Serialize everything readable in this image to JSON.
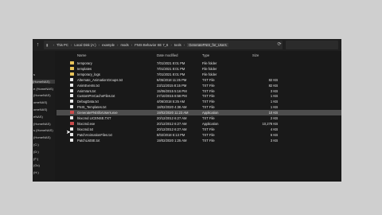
{
  "breadcrumb": [
    "This PC",
    "Local Disk (A:)",
    "example",
    "mods",
    "FNIS Behavior SE 7_6",
    "tools",
    "GenerateFNIS_for_Users"
  ],
  "columns": {
    "name": "Name",
    "date": "Date modified",
    "type": "Type",
    "size": "Size"
  },
  "nav_items": [
    {
      "label": "s",
      "selected": false
    },
    {
      "label": "(HomeNAS)",
      "selected": true
    },
    {
      "label": "e (HomeNAS)",
      "selected": false
    },
    {
      "label": "(HomeNAS)",
      "selected": false
    },
    {
      "label": "omeNAS)",
      "selected": false
    },
    {
      "label": "omeNAS)",
      "selected": false
    },
    {
      "label": "eNAS)",
      "selected": false
    },
    {
      "label": "(HomeNAS)",
      "selected": false
    },
    {
      "label": "s (HomeNAS)",
      "selected": false
    },
    {
      "label": "(HomeNAS)",
      "selected": false
    },
    {
      "label": "(C:)",
      "selected": false
    },
    {
      "label": "(D:)",
      "selected": false
    },
    {
      "label": "(F:)",
      "selected": false
    },
    {
      "label": "(Gc)",
      "selected": false
    },
    {
      "label": "(H:)",
      "selected": false
    }
  ],
  "files": [
    {
      "name": "temporary",
      "date": "7/01/2021 8:01 PM",
      "type": "File folder",
      "size": "",
      "icon": "folder"
    },
    {
      "name": "templates",
      "date": "7/01/2021 8:01 PM",
      "type": "File folder",
      "size": "",
      "icon": "folder"
    },
    {
      "name": "temporary_logs",
      "date": "7/01/2021 8:01 PM",
      "type": "File folder",
      "size": "",
      "icon": "folder"
    },
    {
      "name": "Alternate_AnimationGroups.txt",
      "date": "6/05/2018 11:25 PM",
      "type": "TXT File",
      "size": "82 KB",
      "icon": "file"
    },
    {
      "name": "AnimEvents.txt",
      "date": "23/11/2015 8:15 PM",
      "type": "TXT File",
      "size": "82 KB",
      "icon": "file"
    },
    {
      "name": "AnimVars.txt",
      "date": "15/06/2015 5:16 PM",
      "type": "TXT File",
      "size": "3 KB",
      "icon": "file"
    },
    {
      "name": "CustomPreCacheFiles.txt",
      "date": "27/10/2015 8:58 PM",
      "type": "TXT File",
      "size": "1 KB",
      "icon": "file"
    },
    {
      "name": "DebugData.txt",
      "date": "4/06/2018 5:25 AM",
      "type": "TXT File",
      "size": "1 KB",
      "icon": "file"
    },
    {
      "name": "FNIS_Templates.txt",
      "date": "18/02/2020 4:38 AM",
      "type": "TXT File",
      "size": "1 KB",
      "icon": "file"
    },
    {
      "name": "GenerateFNISforUsers.exe",
      "date": "19/02/2020 11:23 AM",
      "type": "Application",
      "size": "10 KB",
      "icon": "app"
    },
    {
      "name": "hkxcmd LICENSE.TXT",
      "date": "20/12/2012 6:27 AM",
      "type": "TXT File",
      "size": "2 KB",
      "icon": "file"
    },
    {
      "name": "hkxcmd.exe",
      "date": "20/12/2012 6:27 AM",
      "type": "Application",
      "size": "10,278 KB",
      "icon": "app"
    },
    {
      "name": "hkxcmd.txt",
      "date": "20/12/2012 6:27 AM",
      "type": "TXT File",
      "size": "4 KB",
      "icon": "file"
    },
    {
      "name": "PatchAnimationFiles.txt",
      "date": "8/02/2018 6:13 PM",
      "type": "TXT File",
      "size": "6 KB",
      "icon": "file"
    },
    {
      "name": "PatchListSE.txt",
      "date": "19/02/2020 1:25 AM",
      "type": "TXT File",
      "size": "3 KB",
      "icon": "file"
    }
  ],
  "highlighted_row": 9,
  "colors": {
    "window_bg": "#191919",
    "highlight": "#4c4c4c",
    "folder": "#e8c35a",
    "page_bg": "#cfcfcf"
  }
}
